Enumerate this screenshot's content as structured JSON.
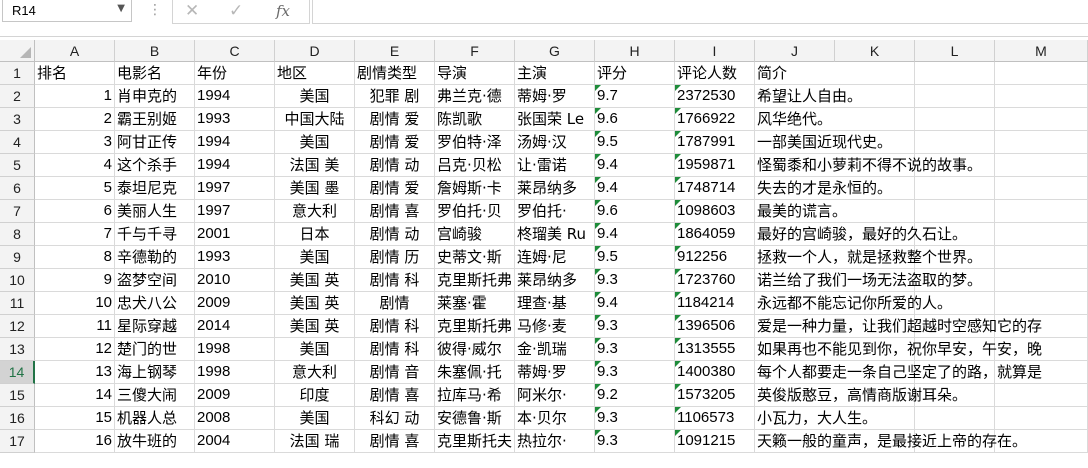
{
  "formula_bar": {
    "name_box": "R14",
    "cancel_icon": "✕",
    "enter_icon": "✓",
    "fx_label": "fx",
    "formula": ""
  },
  "columns": [
    "A",
    "B",
    "C",
    "D",
    "E",
    "F",
    "G",
    "H",
    "I",
    "J",
    "K",
    "L",
    "M"
  ],
  "header_row": [
    "排名",
    "电影名",
    "年份",
    "地区",
    "剧情类型",
    "导演",
    "主演",
    "评分",
    "评论人数",
    "简介"
  ],
  "selected_row": 14,
  "accent_color": "#217346",
  "rows": [
    {
      "n": "2",
      "rank": "1",
      "title": "肖申克的",
      "year": "1994",
      "region": "美国",
      "genre": "犯罪 剧",
      "director": "弗兰克·德",
      "star": "蒂姆·罗",
      "score": "9.7",
      "count": "2372530",
      "intro": "希望让人自由。"
    },
    {
      "n": "3",
      "rank": "2",
      "title": "霸王别姬",
      "year": "1993",
      "region": "中国大陆",
      "genre": "剧情 爱",
      "director": "陈凯歌",
      "star": "张国荣 Le",
      "score": "9.6",
      "count": "1766922",
      "intro": "风华绝代。"
    },
    {
      "n": "4",
      "rank": "3",
      "title": "阿甘正传",
      "year": "1994",
      "region": "美国",
      "genre": "剧情 爱",
      "director": "罗伯特·泽",
      "star": "汤姆·汉",
      "score": "9.5",
      "count": "1787991",
      "intro": "一部美国近现代史。"
    },
    {
      "n": "5",
      "rank": "4",
      "title": "这个杀手",
      "year": "1994",
      "region": "法国 美",
      "genre": "剧情 动",
      "director": "吕克·贝松",
      "star": "让·雷诺",
      "score": "9.4",
      "count": "1959871",
      "intro": "怪蜀黍和小萝莉不得不说的故事。"
    },
    {
      "n": "6",
      "rank": "5",
      "title": "泰坦尼克",
      "year": "1997",
      "region": "美国 墨",
      "genre": "剧情 爱",
      "director": "詹姆斯·卡",
      "star": "莱昂纳多",
      "score": "9.4",
      "count": "1748714",
      "intro": "失去的才是永恒的。"
    },
    {
      "n": "7",
      "rank": "6",
      "title": "美丽人生",
      "year": "1997",
      "region": "意大利",
      "genre": "剧情 喜",
      "director": "罗伯托·贝",
      "star": "罗伯托·",
      "score": "9.6",
      "count": "1098603",
      "intro": "最美的谎言。"
    },
    {
      "n": "8",
      "rank": "7",
      "title": "千与千寻",
      "year": "2001",
      "region": "日本",
      "genre": "剧情 动",
      "director": "宫崎骏",
      "star": "柊瑠美 Ru",
      "score": "9.4",
      "count": "1864059",
      "intro": "最好的宫崎骏，最好的久石让。"
    },
    {
      "n": "9",
      "rank": "8",
      "title": "辛德勒的",
      "year": "1993",
      "region": "美国",
      "genre": "剧情 历",
      "director": "史蒂文·斯",
      "star": "连姆·尼",
      "score": "9.5",
      "count": "912256",
      "intro": "拯救一个人，就是拯救整个世界。"
    },
    {
      "n": "10",
      "rank": "9",
      "title": "盗梦空间",
      "year": "2010",
      "region": "美国 英",
      "genre": "剧情 科",
      "director": "克里斯托弗",
      "star": "莱昂纳多",
      "score": "9.3",
      "count": "1723760",
      "intro": "诺兰给了我们一场无法盗取的梦。"
    },
    {
      "n": "11",
      "rank": "10",
      "title": "忠犬八公",
      "year": "2009",
      "region": "美国 英",
      "genre": "剧情",
      "director": "莱塞·霍",
      "star": "理查·基",
      "score": "9.4",
      "count": "1184214",
      "intro": "永远都不能忘记你所爱的人。"
    },
    {
      "n": "12",
      "rank": "11",
      "title": "星际穿越",
      "year": "2014",
      "region": "美国 英",
      "genre": "剧情 科",
      "director": "克里斯托弗",
      "star": "马修·麦",
      "score": "9.3",
      "count": "1396506",
      "intro": "爱是一种力量，让我们超越时空感知它的存"
    },
    {
      "n": "13",
      "rank": "12",
      "title": "楚门的世",
      "year": "1998",
      "region": "美国",
      "genre": "剧情 科",
      "director": "彼得·威尔",
      "star": "金·凯瑞",
      "score": "9.3",
      "count": "1313555",
      "intro": "如果再也不能见到你，祝你早安，午安，晚"
    },
    {
      "n": "14",
      "rank": "13",
      "title": "海上钢琴",
      "year": "1998",
      "region": "意大利",
      "genre": "剧情 音",
      "director": "朱塞佩·托",
      "star": "蒂姆·罗",
      "score": "9.3",
      "count": "1400380",
      "intro": "每个人都要走一条自己坚定了的路，就算是"
    },
    {
      "n": "15",
      "rank": "14",
      "title": "三傻大闹",
      "year": "2009",
      "region": "印度",
      "genre": "剧情 喜",
      "director": "拉库马·希",
      "star": "阿米尔·",
      "score": "9.2",
      "count": "1573205",
      "intro": "英俊版憨豆，高情商版谢耳朵。"
    },
    {
      "n": "16",
      "rank": "15",
      "title": "机器人总",
      "year": "2008",
      "region": "美国",
      "genre": "科幻 动",
      "director": "安德鲁·斯",
      "star": "本·贝尔",
      "score": "9.3",
      "count": "1106573",
      "intro": "小瓦力，大人生。"
    },
    {
      "n": "17",
      "rank": "16",
      "title": "放牛班的",
      "year": "2004",
      "region": "法国 瑞",
      "genre": "剧情 喜",
      "director": "克里斯托夫",
      "star": "热拉尔·",
      "score": "9.3",
      "count": "1091215",
      "intro": "天籁一般的童声，是最接近上帝的存在。"
    }
  ]
}
